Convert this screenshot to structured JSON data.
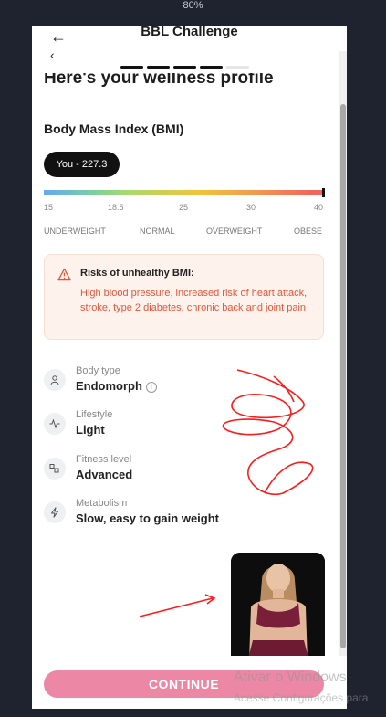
{
  "zoom_level": "80%",
  "app": {
    "title": "BBL Challenge",
    "back_icon": "arrow-left-icon"
  },
  "progress": {
    "segments_total": 5,
    "segments_done": 4,
    "active_color": "#111111",
    "inactive_color": "#e5e5e5"
  },
  "heading": "Here's your wellness profile",
  "bmi": {
    "title": "Body Mass Index (BMI)",
    "you_label": "You - 227.3",
    "ticks": [
      "15",
      "18.5",
      "25",
      "30",
      "40"
    ],
    "categories": [
      "UNDERWEIGHT",
      "NORMAL",
      "OVERWEIGHT",
      "OBESE"
    ]
  },
  "warning": {
    "title": "Risks of unhealthy BMI:",
    "text": "High blood pressure, increased risk of heart attack, stroke, type 2 diabetes, chronic back and joint pain",
    "color": "#e2573b"
  },
  "profile": [
    {
      "label": "Body type",
      "value": "Endomorph",
      "icon": "person-icon"
    },
    {
      "label": "Lifestyle",
      "value": "Light",
      "icon": "activity-icon"
    },
    {
      "label": "Fitness level",
      "value": "Advanced",
      "icon": "fitness-icon"
    },
    {
      "label": "Metabolism",
      "value": "Slow, easy to gain weight",
      "icon": "lightning-icon"
    }
  ],
  "continue_label": "CONTINUE",
  "accent_color": "#ec87a6",
  "windows_watermark": {
    "line1": "Ativar o Windows",
    "line2": "Acesse Configurações para"
  }
}
